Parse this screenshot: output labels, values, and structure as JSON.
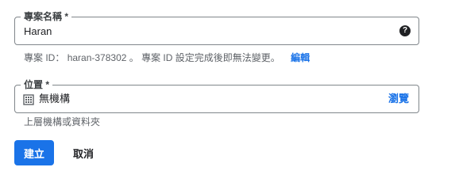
{
  "project_name": {
    "label": "專案名稱 *",
    "value": "Haran",
    "help_icon": "help-circle-icon"
  },
  "project_id_hint": {
    "prefix": "專案 ID：",
    "id": "haran-378302",
    "suffix": "。 專案 ID 設定完成後即無法變更。",
    "edit_label": "編輯"
  },
  "location": {
    "label": "位置 *",
    "icon": "organization-icon",
    "value": "無機構",
    "browse_label": "瀏覽",
    "hint": "上層機構或資料夾"
  },
  "actions": {
    "create_label": "建立",
    "cancel_label": "取消"
  },
  "colors": {
    "primary": "#1a73e8",
    "text": "#202124",
    "secondary_text": "#5f6368",
    "border": "#80868b"
  }
}
